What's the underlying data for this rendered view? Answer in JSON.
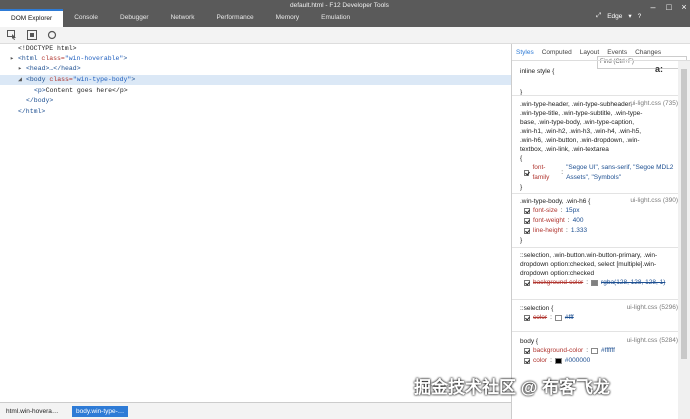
{
  "window": {
    "title": "default.html - F12 Developer Tools",
    "browser_label": "Edge"
  },
  "tabs": [
    {
      "label": "DOM Explorer",
      "active": true
    },
    {
      "label": "Console"
    },
    {
      "label": "Debugger"
    },
    {
      "label": "Network"
    },
    {
      "label": "Performance"
    },
    {
      "label": "Memory"
    },
    {
      "label": "Emulation"
    }
  ],
  "find": {
    "placeholder": "Find (Ctrl+F)"
  },
  "dom_lines": [
    {
      "text": "<!DOCTYPE html>"
    },
    {
      "arrow": "▸",
      "open": "<html",
      "attr": "class=",
      "val": "\"win-hoverable\"",
      "close": ">"
    },
    {
      "arrow": "▸",
      "open": "<head>",
      "rest": "…</head>"
    },
    {
      "arrow": "◢",
      "open": "<body",
      "attr": "class=",
      "val": "\"win-type-body\"",
      "close": ">"
    },
    {
      "open": "<p>",
      "rest": "Content goes here</p>"
    },
    {
      "open": "</body>"
    },
    {
      "open": "</html>"
    }
  ],
  "right_tabs": [
    {
      "label": "Styles",
      "active": true
    },
    {
      "label": "Computed"
    },
    {
      "label": "Layout"
    },
    {
      "label": "Events"
    },
    {
      "label": "Changes"
    }
  ],
  "inline_style": {
    "label": "inline style",
    "open": "{",
    "close": "}",
    "add_label": "a:"
  },
  "rules": [
    {
      "selector": ".win-type-header, .win-type-subheader, .win-type-title, .win-type-subtitle, .win-type-base, .win-type-body, .win-type-caption, .win-h1, .win-h2, .win-h3, .win-h4, .win-h5, .win-h6, .win-button, .win-dropdown, .win-textbox, .win-link, .win-textarea",
      "source": "ui-light.css (735)",
      "props": [
        {
          "name": "font-family",
          "value": "\"Segoe UI\", sans-serif, \"Segoe MDL2 Assets\", \"Symbols\""
        }
      ]
    },
    {
      "selector": ".win-type-body, .win-h6",
      "source": "ui-light.css (390)",
      "props": [
        {
          "name": "font-size",
          "value": "15px"
        },
        {
          "name": "font-weight",
          "value": "400"
        },
        {
          "name": "line-height",
          "value": "1.333"
        }
      ]
    },
    {
      "selector": "::selection, .win-button.win-button-primary, .win-dropdown option:checked, select [multiple].win-dropdown option:checked",
      "source": "",
      "props": [
        {
          "name": "background-color",
          "value": "rgba(128, 128, 128, 1)",
          "struck": true,
          "swatch": "#808080"
        }
      ]
    },
    {
      "selector": "::selection",
      "source": "ui-light.css (5296)",
      "props": [
        {
          "name": "color",
          "value": "#fff",
          "struck": true,
          "swatch": "#ffffff"
        }
      ]
    },
    {
      "selector": "body",
      "source": "ui-light.css (5284)",
      "props": [
        {
          "name": "background-color",
          "value": "#ffffff",
          "swatch": "#ffffff"
        },
        {
          "name": "color",
          "value": "#000000",
          "swatch": "#000000"
        }
      ]
    }
  ],
  "breadcrumbs": [
    {
      "label": "html.win-hovera…"
    },
    {
      "label": "body.win-type-…",
      "active": true
    }
  ],
  "watermark": "掘金技术社区 @ 布客飞龙",
  "colors": {
    "accent": "#2e7bd6",
    "titlebar": "#5a5a5a",
    "selection": "#dbe8f6"
  }
}
